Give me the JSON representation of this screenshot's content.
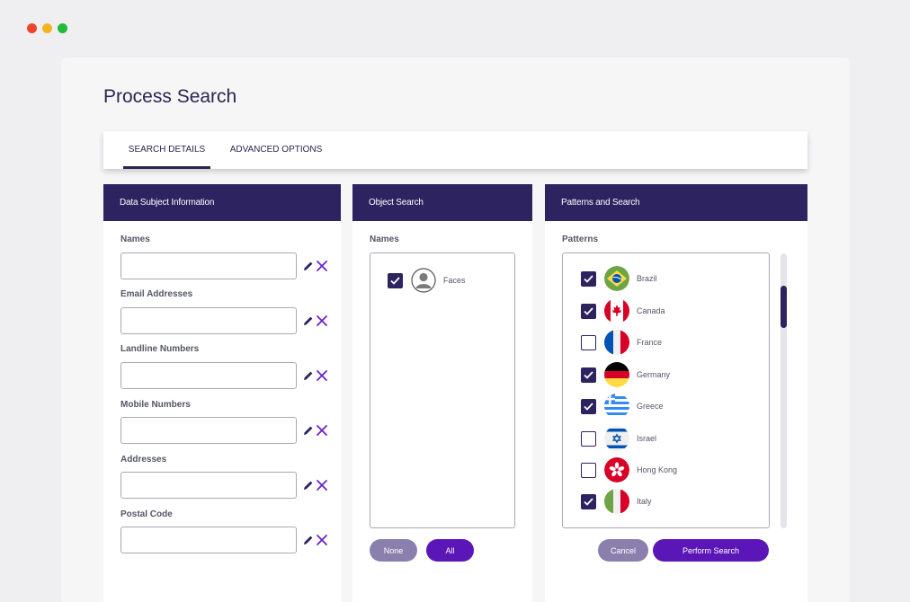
{
  "window": {
    "dots": [
      "#f0432b",
      "#f3b422",
      "#23b939"
    ]
  },
  "page": {
    "title": "Process Search"
  },
  "tabs": [
    {
      "label": "SEARCH DETAILS",
      "active": true
    },
    {
      "label": "ADVANCED OPTIONS",
      "active": false
    }
  ],
  "panels": {
    "data_subject": {
      "title": "Data Subject Information",
      "fields": [
        {
          "label": "Names",
          "value": "",
          "placeholder": ""
        },
        {
          "label": "Email Addresses",
          "value": "",
          "placeholder": ""
        },
        {
          "label": "Landline Numbers",
          "value": "",
          "placeholder": ""
        },
        {
          "label": "Mobile Numbers",
          "value": "",
          "placeholder": ""
        },
        {
          "label": "Addresses",
          "value": "",
          "placeholder": ""
        },
        {
          "label": "Postal Code",
          "value": "",
          "placeholder": ""
        }
      ],
      "icons": {
        "edit": "pencil-icon",
        "clear": "close-icon"
      }
    },
    "object_search": {
      "title": "Object Search",
      "list_label": "Names",
      "items": [
        {
          "label": "Faces",
          "checked": true,
          "icon": "avatar-icon"
        }
      ],
      "buttons": {
        "none": "None",
        "all": "All"
      }
    },
    "patterns": {
      "title": "Patterns and Search",
      "list_label": "Patterns",
      "items": [
        {
          "label": "Brazil",
          "checked": true,
          "icon": "brazil-flag-icon"
        },
        {
          "label": "Canada",
          "checked": true,
          "icon": "canada-flag-icon"
        },
        {
          "label": "France",
          "checked": false,
          "icon": "france-flag-icon"
        },
        {
          "label": "Germany",
          "checked": true,
          "icon": "germany-flag-icon"
        },
        {
          "label": "Greece",
          "checked": true,
          "icon": "greece-flag-icon"
        },
        {
          "label": "Israel",
          "checked": false,
          "icon": "israel-flag-icon"
        },
        {
          "label": "Hong Kong",
          "checked": false,
          "icon": "hong-kong-flag-icon"
        },
        {
          "label": "Italy",
          "checked": true,
          "icon": "italy-flag-icon"
        }
      ],
      "buttons": {
        "cancel": "Cancel",
        "perform": "Perform Search"
      }
    }
  },
  "colors": {
    "brand": "#2c2360",
    "accent": "#5b16b8",
    "muted_button": "#8b80ad"
  }
}
